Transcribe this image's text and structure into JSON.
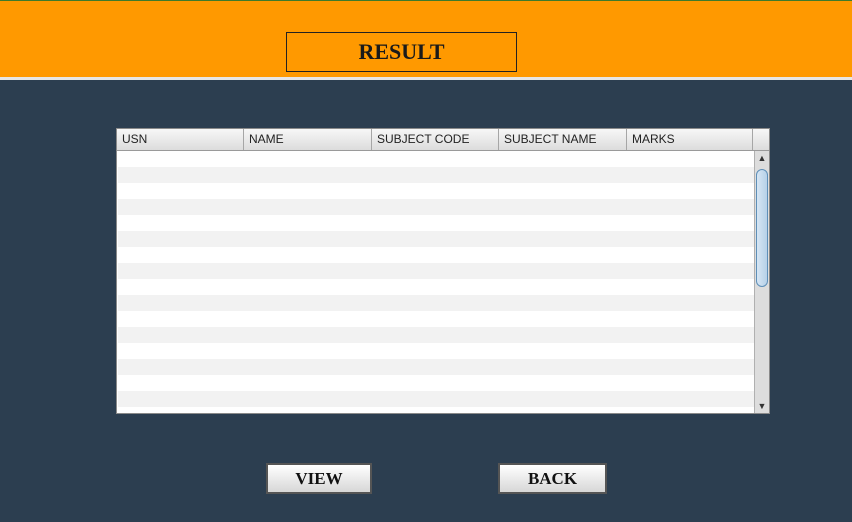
{
  "header": {
    "title": "RESULT"
  },
  "table": {
    "columns": [
      "USN",
      "NAME",
      "SUBJECT CODE",
      "SUBJECT NAME",
      "MARKS"
    ],
    "rows": []
  },
  "scrollbar": {
    "up_arrow": "▲",
    "down_arrow": "▼"
  },
  "actions": {
    "view_label": "VIEW",
    "back_label": "BACK"
  },
  "colors": {
    "header_bg": "#ff9900",
    "body_bg": "#2c3e50"
  }
}
